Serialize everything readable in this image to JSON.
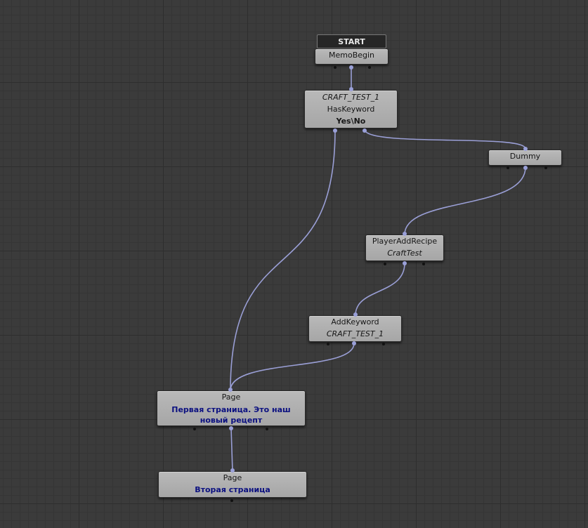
{
  "start": {
    "label": "START"
  },
  "nodes": {
    "memo_begin": {
      "title": "MemoBegin"
    },
    "has_keyword": {
      "param": "CRAFT_TEST_1",
      "title": "HasKeyword",
      "result": "Yes\\No"
    },
    "dummy": {
      "title": "Dummy"
    },
    "player_add_recipe": {
      "title": "PlayerAddRecipe",
      "param": "CraftTest"
    },
    "add_keyword": {
      "title": "AddKeyword",
      "param": "CRAFT_TEST_1"
    },
    "page_1": {
      "title": "Page",
      "text": "Первая страница. Это наш новый рецепт"
    },
    "page_2": {
      "title": "Page",
      "text": "Вторая страница"
    }
  },
  "colors": {
    "wire": "#9a9fd6",
    "canvas": "#3b3b3b",
    "node": "#b0b0b0",
    "page_text": "#0b1080"
  }
}
